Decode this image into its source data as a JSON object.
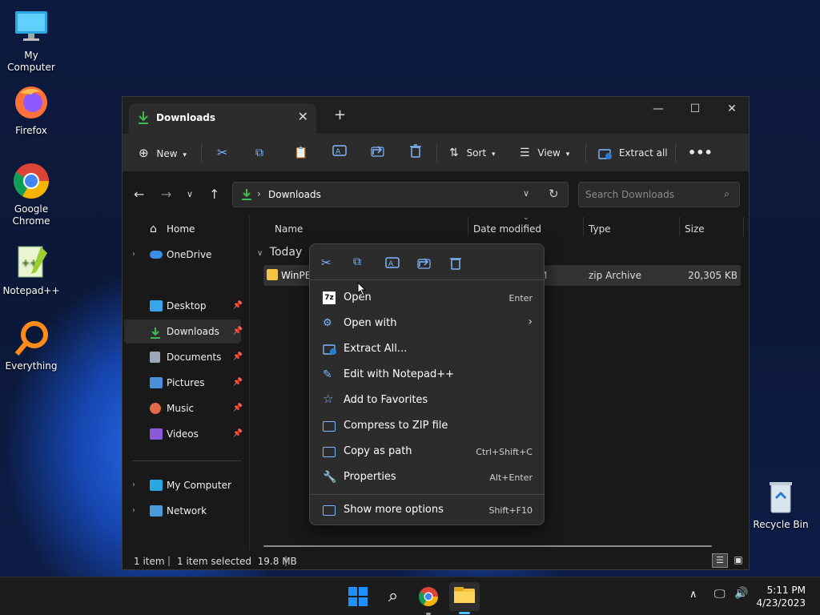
{
  "desktop": {
    "icons": [
      {
        "label": "My Computer"
      },
      {
        "label": "Firefox"
      },
      {
        "label": "Google Chrome"
      },
      {
        "label": "Notepad++"
      },
      {
        "label": "Everything"
      },
      {
        "label": "Recycle Bin"
      }
    ]
  },
  "window": {
    "tab_title": "Downloads",
    "toolbar": {
      "new_label": "New",
      "sort_label": "Sort",
      "view_label": "View",
      "extract_label": "Extract all"
    },
    "address": {
      "path": "Downloads",
      "search_placeholder": "Search Downloads"
    },
    "sidebar": {
      "items": [
        {
          "label": "Home"
        },
        {
          "label": "OneDrive"
        },
        {
          "label": "Desktop"
        },
        {
          "label": "Downloads"
        },
        {
          "label": "Documents"
        },
        {
          "label": "Pictures"
        },
        {
          "label": "Music"
        },
        {
          "label": "Videos"
        },
        {
          "label": "My Computer"
        },
        {
          "label": "Network"
        }
      ]
    },
    "columns": {
      "name": "Name",
      "date": "Date modified",
      "type": "Type",
      "size": "Size"
    },
    "group_label": "Today",
    "file": {
      "name": "WinPEI",
      "date_fragment": "M",
      "type": "zip Archive",
      "size": "20,305 KB"
    },
    "status": {
      "items": "1 item",
      "selected": "1 item selected  19.8 MB"
    }
  },
  "context_menu": {
    "items": [
      {
        "label": "Open",
        "shortcut": "Enter"
      },
      {
        "label": "Open with",
        "shortcut": ""
      },
      {
        "label": "Extract All...",
        "shortcut": ""
      },
      {
        "label": "Edit with Notepad++",
        "shortcut": ""
      },
      {
        "label": "Add to Favorites",
        "shortcut": ""
      },
      {
        "label": "Compress to ZIP file",
        "shortcut": ""
      },
      {
        "label": "Copy as path",
        "shortcut": "Ctrl+Shift+C"
      },
      {
        "label": "Properties",
        "shortcut": "Alt+Enter"
      },
      {
        "label": "Show more options",
        "shortcut": "Shift+F10"
      }
    ]
  },
  "taskbar": {
    "time": "5:11 PM",
    "date": "4/23/2023"
  },
  "colors": {
    "accent": "#4cc2ff",
    "download_green": "#3fb950",
    "folder_yellow": "#f4c542"
  }
}
